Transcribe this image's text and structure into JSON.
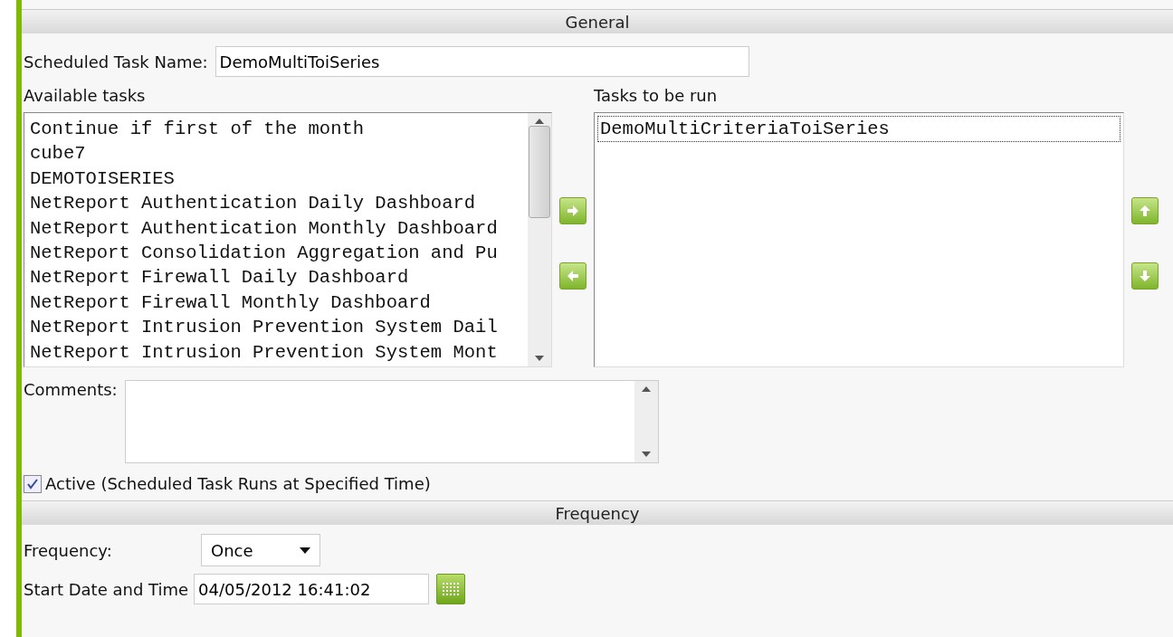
{
  "general": {
    "title": "General",
    "name_label": "Scheduled Task Name:",
    "name_value": "DemoMultiToiSeries",
    "available": {
      "label": "Available tasks",
      "items": [
        {
          "text": "Continue if first of the month",
          "focused": false
        },
        {
          "text": "cube7",
          "focused": false
        },
        {
          "text": "DEMOTOISERIES",
          "focused": false
        },
        {
          "text": "NetReport Authentication Daily Dashboard",
          "focused": false
        },
        {
          "text": "NetReport Authentication Monthly Dashboard",
          "focused": false
        },
        {
          "text": "NetReport Consolidation Aggregation and Pu",
          "focused": false
        },
        {
          "text": "NetReport Firewall Daily Dashboard",
          "focused": false
        },
        {
          "text": "NetReport Firewall Monthly Dashboard",
          "focused": false
        },
        {
          "text": "NetReport Intrusion Prevention System Dail",
          "focused": false
        },
        {
          "text": "NetReport Intrusion Prevention System Mont",
          "focused": false
        }
      ]
    },
    "to_run": {
      "label": "Tasks to be run",
      "items": [
        {
          "text": "DemoMultiCriteriaToiSeries",
          "focused": true
        }
      ]
    },
    "comments_label": "Comments:",
    "active": {
      "label": "Active (Scheduled Task Runs at Specified Time)",
      "checked": true
    }
  },
  "frequency": {
    "title": "Frequency",
    "frequency_label": "Frequency:",
    "frequency_value": "Once",
    "start_label": "Start Date and Time",
    "start_value": "04/05/2012 16:41:02"
  }
}
